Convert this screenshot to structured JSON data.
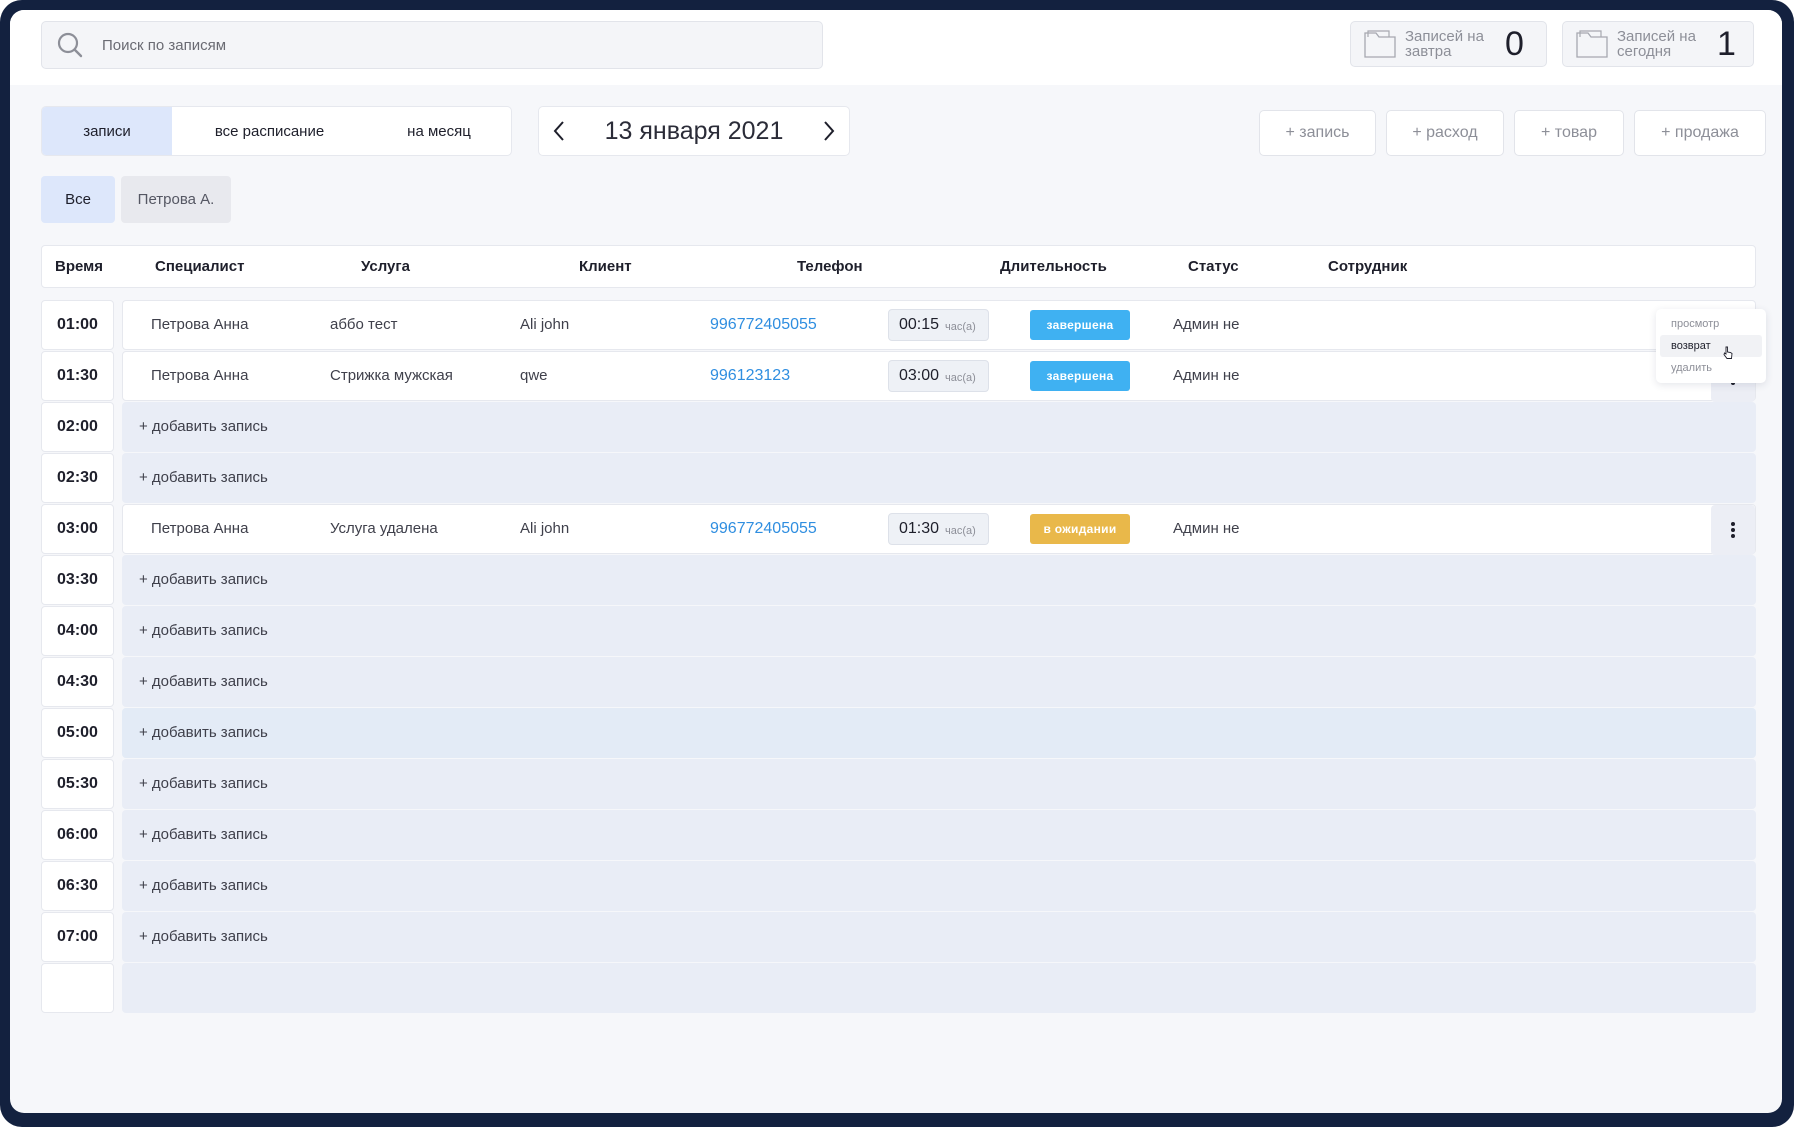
{
  "search": {
    "placeholder": "Поиск по записям",
    "icon": "search-icon"
  },
  "counters": [
    {
      "label": "Записей на завтра",
      "value": "0",
      "icon": "folder-icon"
    },
    {
      "label": "Записей на сегодня",
      "value": "1",
      "icon": "folder-icon"
    }
  ],
  "tabs": [
    {
      "label": "записи",
      "active": true
    },
    {
      "label": "все расписание",
      "active": false
    },
    {
      "label": "на месяц",
      "active": false
    }
  ],
  "date_nav": {
    "date": "13 января 2021",
    "prev_icon": "chevron-left-icon",
    "next_icon": "chevron-right-icon"
  },
  "actions": [
    "+ запись",
    "+ расход",
    "+ товар",
    "+ продажа"
  ],
  "filters": [
    {
      "label": "Все",
      "active": true
    },
    {
      "label": "Петрова А.",
      "active": false
    }
  ],
  "table": {
    "columns": [
      "Время",
      "Специалист",
      "Услуга",
      "Клиент",
      "Телефон",
      "Длительность",
      "Статус",
      "Сотрудник"
    ],
    "add_label": "+ добавить запись",
    "duration_unit": "час(а)",
    "rows": [
      {
        "time": "01:00",
        "specialist": "Петрова Анна",
        "service": "аббо тест",
        "client": "Ali john",
        "phone": "996772405055",
        "duration": "00:15",
        "status": "завершена",
        "status_color": "#3fb1f2",
        "employee": "Админ не"
      },
      {
        "time": "01:30",
        "specialist": "Петрова Анна",
        "service": "Стрижка мужская",
        "client": "qwe",
        "phone": "996123123",
        "duration": "03:00",
        "status": "завершена",
        "status_color": "#3fb1f2",
        "employee": "Админ не"
      },
      {
        "time": "02:00"
      },
      {
        "time": "02:30"
      },
      {
        "time": "03:00",
        "specialist": "Петрова Анна",
        "service": "Услуга удалена",
        "client": "Ali john",
        "phone": "996772405055",
        "duration": "01:30",
        "status": "в ожидании",
        "status_color": "#e9b84a",
        "employee": "Админ не"
      },
      {
        "time": "03:30"
      },
      {
        "time": "04:00"
      },
      {
        "time": "04:30"
      },
      {
        "time": "05:00"
      },
      {
        "time": "05:30"
      },
      {
        "time": "06:00"
      },
      {
        "time": "06:30"
      },
      {
        "time": "07:00"
      },
      {
        "time": ""
      }
    ]
  },
  "row_menu": {
    "items": [
      {
        "label": "просмотр",
        "active": false
      },
      {
        "label": "возврат",
        "active": true
      },
      {
        "label": "удалить",
        "active": false
      }
    ]
  },
  "colors": {
    "accent": "#dde7fb",
    "empty_row": "#e9edf6",
    "phone": "#2f8ee0",
    "frame": "#13213f"
  }
}
